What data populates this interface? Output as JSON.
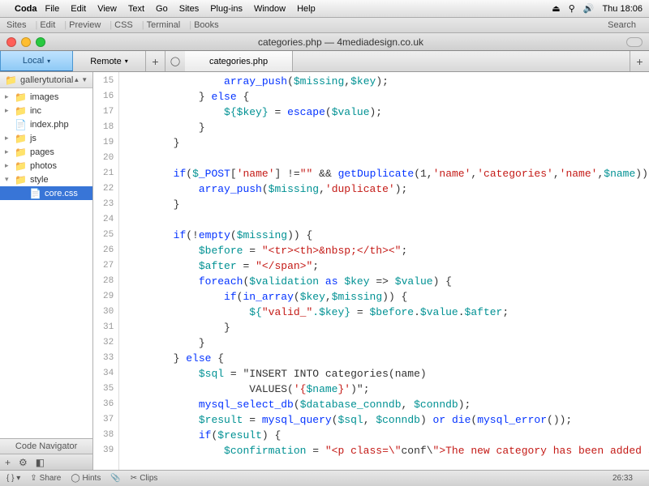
{
  "menubar": {
    "appname": "Coda",
    "items": [
      "File",
      "Edit",
      "View",
      "Text",
      "Go",
      "Sites",
      "Plug-ins",
      "Window",
      "Help"
    ],
    "clock": "Thu 18:06"
  },
  "toolbar": {
    "items": [
      "Sites",
      "Edit",
      "Preview",
      "CSS",
      "Terminal",
      "Books"
    ],
    "search": "Search"
  },
  "window": {
    "title": "categories.php — 4mediadesign.co.uk"
  },
  "tabs": {
    "local": "Local",
    "remote": "Remote",
    "file": "categories.php"
  },
  "sidebar": {
    "root": "gallerytutorial",
    "items": [
      {
        "type": "folder",
        "name": "images",
        "open": false
      },
      {
        "type": "folder",
        "name": "inc",
        "open": false
      },
      {
        "type": "file",
        "name": "index.php"
      },
      {
        "type": "folder",
        "name": "js",
        "open": false
      },
      {
        "type": "folder",
        "name": "pages",
        "open": false
      },
      {
        "type": "folder",
        "name": "photos",
        "open": false
      },
      {
        "type": "folder",
        "name": "style",
        "open": true
      },
      {
        "type": "file",
        "name": "core.css",
        "child": true,
        "selected": true
      }
    ],
    "codenav": "Code Navigator"
  },
  "editor": {
    "first_line": 15,
    "lines": [
      "                array_push($missing,$key);",
      "            } else {",
      "                ${$key} = escape($value);",
      "            }",
      "        }",
      "",
      "        if($_POST['name'] !=\"\" && getDuplicate(1,'name','categories','name',$name)) {",
      "            array_push($missing,'duplicate');",
      "        }",
      "",
      "        if(!empty($missing)) {",
      "            $before = \"<tr><th>&nbsp;</th><\";",
      "            $after = \"</span>\";",
      "            foreach($validation as $key => $value) {",
      "                if(in_array($key,$missing)) {",
      "                    ${\"valid_\".$key} = $before.$value.$after;",
      "                }",
      "            }",
      "        } else {",
      "            $sql = \"INSERT INTO categories(name)",
      "                    VALUES('{$name}')\";",
      "            mysql_select_db($database_conndb, $conndb);",
      "            $result = mysql_query($sql, $conndb) or die(mysql_error());",
      "            if($result) {",
      "                $confirmation = \"<p class=\\\"conf\\\">The new category has been added successfully.</p>\";"
    ]
  },
  "statusbar": {
    "share": "Share",
    "hints": "Hints",
    "clips": "Clips",
    "pos": "26:33"
  }
}
